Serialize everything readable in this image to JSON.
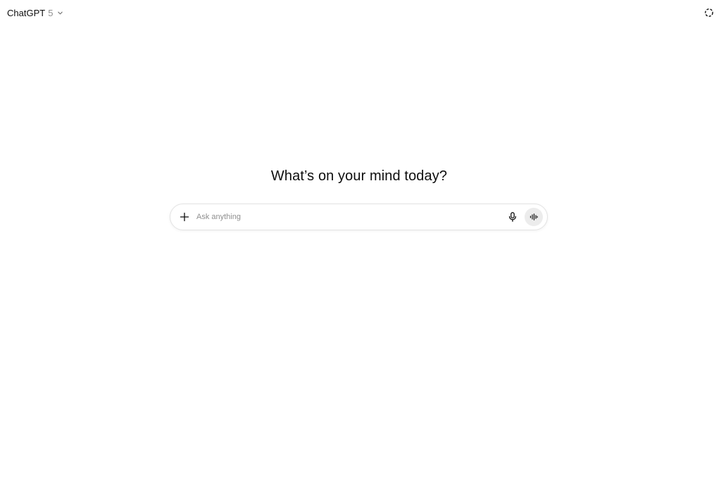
{
  "header": {
    "model_name": "ChatGPT",
    "model_version": "5",
    "dropdown_icon": "chevron-down-icon",
    "temporary_chat_icon": "dashed-circle-icon"
  },
  "main": {
    "headline": "What’s on your mind today?"
  },
  "composer": {
    "placeholder": "Ask anything",
    "value": "",
    "add_icon": "plus-icon",
    "dictate_icon": "microphone-icon",
    "voice_icon": "voice-waveform-icon"
  },
  "colors": {
    "text": "#0d0d0d",
    "muted": "#8f8f8f",
    "border": "#e3e3e3",
    "voice_button_bg": "#ececec"
  }
}
